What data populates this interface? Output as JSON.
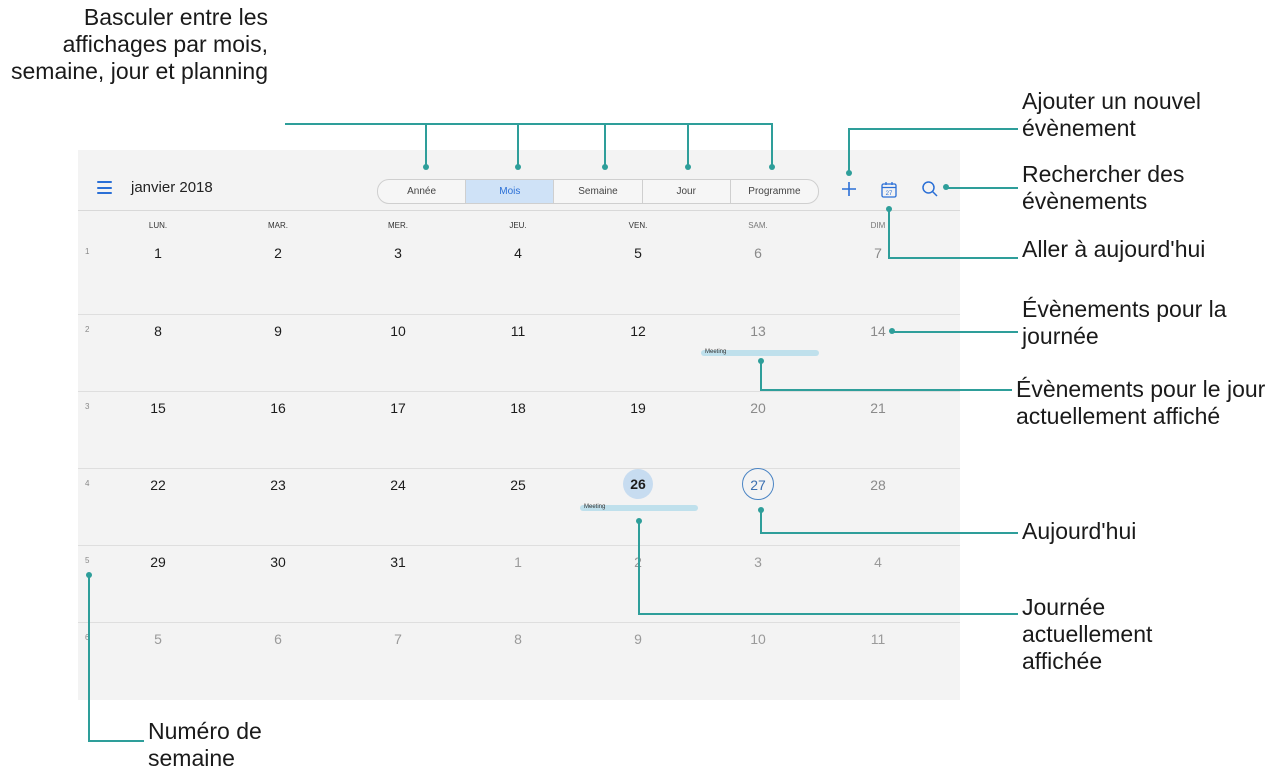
{
  "app": {
    "month_title": "janvier 2018",
    "view_tabs": [
      {
        "label": "Année",
        "active": false
      },
      {
        "label": "Mois",
        "active": true
      },
      {
        "label": "Semaine",
        "active": false
      },
      {
        "label": "Jour",
        "active": false
      },
      {
        "label": "Programme",
        "active": false
      }
    ],
    "toolbar_icons": [
      "menu-icon",
      "plus-icon",
      "calendar-today-icon",
      "search-icon"
    ],
    "today_icon_number": "27",
    "weekdays": [
      "LUN.",
      "MAR.",
      "MER.",
      "JEU.",
      "VEN.",
      "SAM.",
      "DIM"
    ],
    "weeks": [
      {
        "number": "1",
        "days": [
          "1",
          "2",
          "3",
          "4",
          "5",
          "6",
          "7"
        ]
      },
      {
        "number": "2",
        "days": [
          "8",
          "9",
          "10",
          "11",
          "12",
          "13",
          "14"
        ]
      },
      {
        "number": "3",
        "days": [
          "15",
          "16",
          "17",
          "18",
          "19",
          "20",
          "21"
        ]
      },
      {
        "number": "4",
        "days": [
          "22",
          "23",
          "24",
          "25",
          "26",
          "27",
          "28"
        ]
      },
      {
        "number": "5",
        "days": [
          "29",
          "30",
          "31",
          "1",
          "2",
          "3",
          "4"
        ]
      },
      {
        "number": "6",
        "days": [
          "5",
          "6",
          "7",
          "8",
          "9",
          "10",
          "11"
        ]
      }
    ],
    "events": [
      {
        "label": "Meeting",
        "day": "13"
      },
      {
        "label": "Meeting",
        "day": "26"
      }
    ],
    "selected_day": "26",
    "today_day": "27",
    "accent_color": "#2a6fd6",
    "callout_color": "#2e9e9a"
  },
  "annotations": {
    "switch_views": "Basculer entre les affichages par mois, semaine, jour et planning",
    "add_event": "Ajouter un nouvel évènement",
    "search_events": "Rechercher des évènements",
    "go_today": "Aller à aujourd'hui",
    "day_events": "Évènements pour la journée",
    "current_day_events": "Évènements pour le jour actuellement affiché",
    "today": "Aujourd'hui",
    "current_day": "Journée actuellement affichée",
    "week_number": "Numéro de semaine"
  }
}
